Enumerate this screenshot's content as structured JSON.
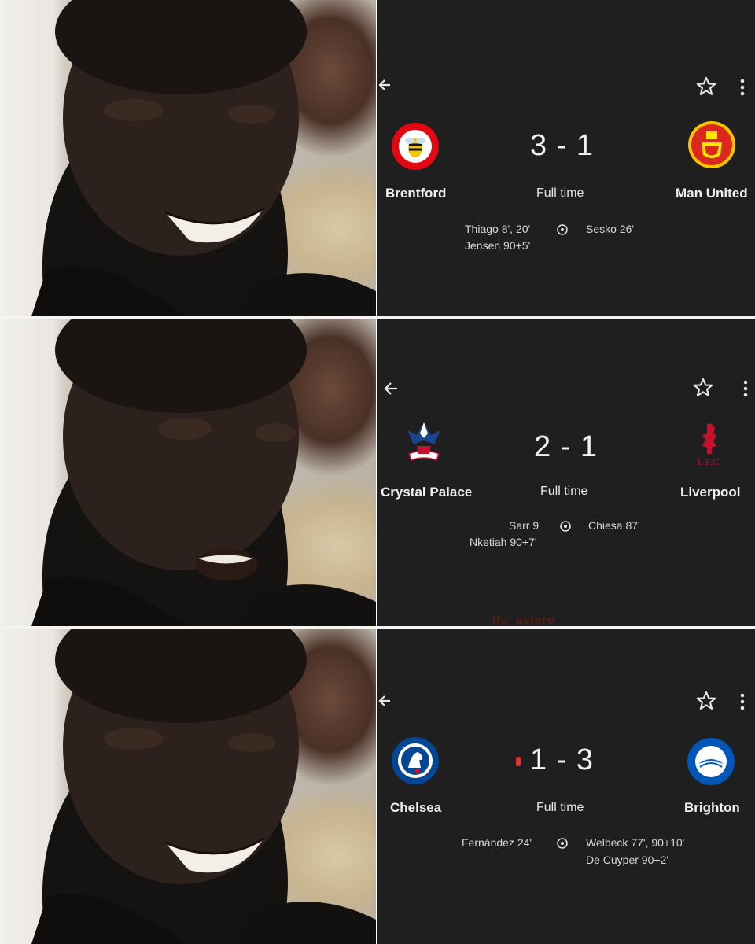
{
  "panels": [
    {
      "home": {
        "name": "Brentford",
        "crest": "brentford-crest"
      },
      "away": {
        "name": "Man United",
        "crest": "man-united-crest"
      },
      "score": "3 - 1",
      "status": "Full time",
      "home_scorers": [
        "Thiago 8', 20'",
        "Jensen 90+5'"
      ],
      "away_scorers": [
        "Sesko 26'"
      ],
      "live_marker": false
    },
    {
      "home": {
        "name": "Crystal Palace",
        "crest": "crystal-palace-crest"
      },
      "away": {
        "name": "Liverpool",
        "crest": "liverpool-crest"
      },
      "score": "2 - 1",
      "status": "Full time",
      "home_scorers": [
        "Sarr 9'",
        "Nketiah 90+7'"
      ],
      "away_scorers": [
        "Chiesa 87'"
      ],
      "live_marker": false
    },
    {
      "home": {
        "name": "Chelsea",
        "crest": "chelsea-crest"
      },
      "away": {
        "name": "Brighton",
        "crest": "brighton-crest"
      },
      "score": "1 - 3",
      "status": "Full time",
      "home_scorers": [
        "Fernández 24'"
      ],
      "away_scorers": [
        "Welbeck 77', 90+10'",
        "De Cuyper 90+2'"
      ],
      "live_marker": true
    }
  ],
  "icons": {
    "back": "back-arrow-icon",
    "favorite": "star-outline-icon",
    "menu": "more-vert-icon",
    "goal": "soccer-ball-icon"
  },
  "watermark": "lfc_aviero",
  "colors": {
    "card_bg": "#1f1f1f",
    "text": "#f0f0f0",
    "live_red": "#e5322d",
    "brentford_red": "#e30613",
    "united_red": "#da291c",
    "palace_blue": "#1b458f",
    "liverpool_red": "#c8102e",
    "chelsea_blue": "#034694",
    "brighton_blue": "#0057b8"
  }
}
